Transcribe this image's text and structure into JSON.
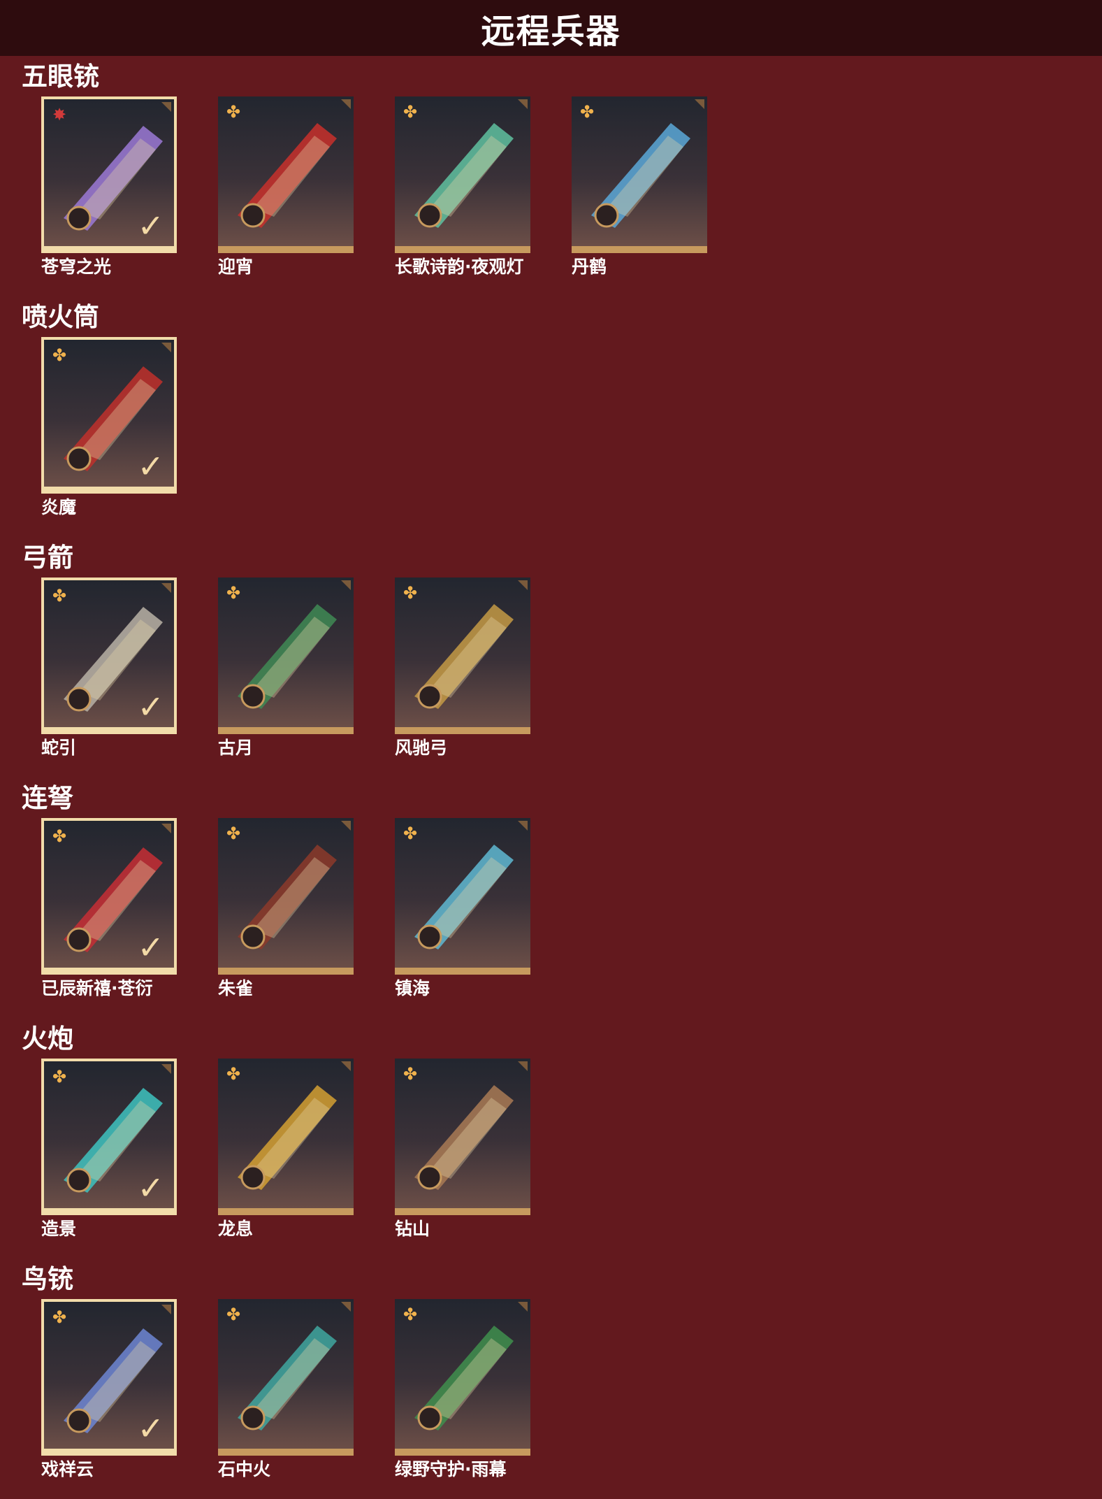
{
  "header": {
    "title": "远程兵器"
  },
  "colors": {
    "background": "#63191e",
    "header": "#2e0c0e",
    "frame": "#c79a5e",
    "selected_frame": "#f2dcaa",
    "badge": "#f0b24d"
  },
  "sections": [
    {
      "title": "五眼铳",
      "items": [
        {
          "label": "苍穹之光",
          "selected": true,
          "badge": "red-star-icon",
          "color": "#9b79d6"
        },
        {
          "label": "迎宵",
          "selected": false,
          "badge": "gold-flower-icon",
          "color": "#c8302c"
        },
        {
          "label": "长歌诗韵·夜观灯",
          "selected": false,
          "badge": "gold-flower-icon",
          "color": "#5fc1a0"
        },
        {
          "label": "丹鹤",
          "selected": false,
          "badge": "gold-flower-icon",
          "color": "#5ba8d8"
        }
      ]
    },
    {
      "title": "喷火筒",
      "items": [
        {
          "label": "炎魔",
          "selected": true,
          "badge": "gold-flower-icon",
          "color": "#c0302b"
        }
      ]
    },
    {
      "title": "弓箭",
      "items": [
        {
          "label": "蛇引",
          "selected": true,
          "badge": "gold-flower-icon",
          "color": "#b9b2a6"
        },
        {
          "label": "古月",
          "selected": false,
          "badge": "gold-flower-icon",
          "color": "#3f8a55"
        },
        {
          "label": "风驰弓",
          "selected": false,
          "badge": "gold-flower-icon",
          "color": "#c49a45"
        }
      ]
    },
    {
      "title": "连弩",
      "items": [
        {
          "label": "已辰新禧·苍衍",
          "selected": true,
          "badge": "gold-flower-icon",
          "color": "#c72e35"
        },
        {
          "label": "朱雀",
          "selected": false,
          "badge": "gold-flower-icon",
          "color": "#8c3a2a"
        },
        {
          "label": "镇海",
          "selected": false,
          "badge": "gold-flower-icon",
          "color": "#5fb8d2"
        }
      ]
    },
    {
      "title": "火炮",
      "items": [
        {
          "label": "造景",
          "selected": true,
          "badge": "gold-flower-icon",
          "color": "#3ec3c0"
        },
        {
          "label": "龙息",
          "selected": false,
          "badge": "gold-flower-icon",
          "color": "#d4a032"
        },
        {
          "label": "钻山",
          "selected": false,
          "badge": "gold-flower-icon",
          "color": "#a97a55"
        }
      ]
    },
    {
      "title": "鸟铳",
      "items": [
        {
          "label": "戏祥云",
          "selected": true,
          "badge": "gold-flower-icon",
          "color": "#6d86d4"
        },
        {
          "label": "石中火",
          "selected": false,
          "badge": "gold-flower-icon",
          "color": "#3fa7a0"
        },
        {
          "label": "绿野守护·雨幕",
          "selected": false,
          "badge": "gold-flower-icon",
          "color": "#3f8f4e"
        }
      ]
    }
  ]
}
